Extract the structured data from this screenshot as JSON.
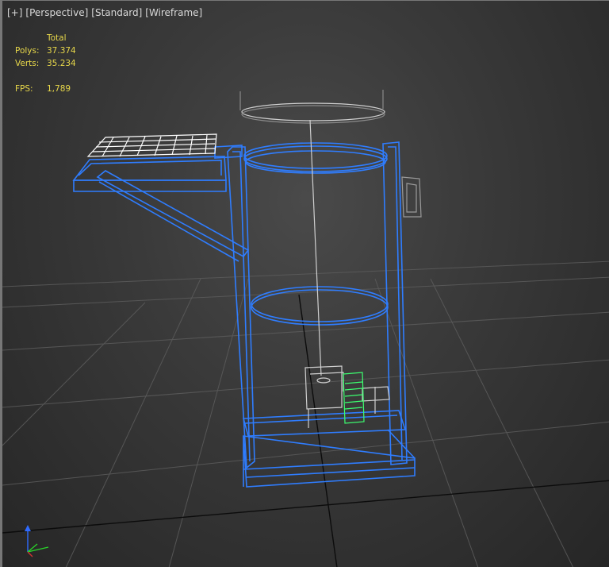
{
  "viewport_label": {
    "plus": "[+]",
    "view": "[Perspective]",
    "shading_preset": "[Standard]",
    "display_mode": "[Wireframe]"
  },
  "stats": {
    "header": "Total",
    "polys_label": "Polys:",
    "polys_value": "37.374",
    "verts_label": "Verts:",
    "verts_value": "35.234",
    "fps_label": "FPS:",
    "fps_value": "1,789"
  },
  "colors": {
    "selected_wire": "#2f7dff",
    "unselected_wire": "#cfcfcf",
    "highlight_wire": "#3cff70",
    "grid": "#5c5c5c",
    "grid_axis": "#0c0c0c",
    "stats_text": "#e8d84a",
    "axis_x": "#29d329",
    "axis_y": "#2f6bff"
  },
  "axis_gizmo": {
    "x_label": "",
    "y_label": "",
    "z_label": ""
  }
}
